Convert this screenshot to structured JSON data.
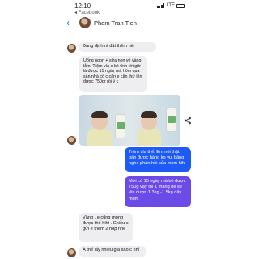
{
  "status": {
    "time": "12:10",
    "back_app": "◂ Facebook",
    "network": "LTE"
  },
  "header": {
    "contact_name": "Pham Tran Tien"
  },
  "messages": {
    "m1": "Đang định nt đặt thêm nè",
    "m2": "Uống ngon + sữa non về vàng lắm. Trộm vía e bé tính tới giờ là được 15 ngày mà hôm qua sản nhà có c cân e cân thử lên được 750gr rồi ý c",
    "m3": "Trộm vía thế. Em nói thật bán được hàng ko vui bằng nghe phản hồi của mom hihi",
    "m4": "Mới có 15 ngày mà bé được 750g vậy thì 1 tháng bé sẽ lên được 1.3kg -1.5kg đấy mom",
    "m5": "Vâng . e cũng mong được thế hihi . Chiều c gửi e thêm 2 hộp nhé",
    "m6": "À thế lấy nhiêu giá sao c nhỉ"
  },
  "colors": {
    "outgoing_blue": "#1e5af6",
    "outgoing_purple": "#6b4be8",
    "incoming_gray": "#eeeef0",
    "accent": "#1877f2"
  }
}
